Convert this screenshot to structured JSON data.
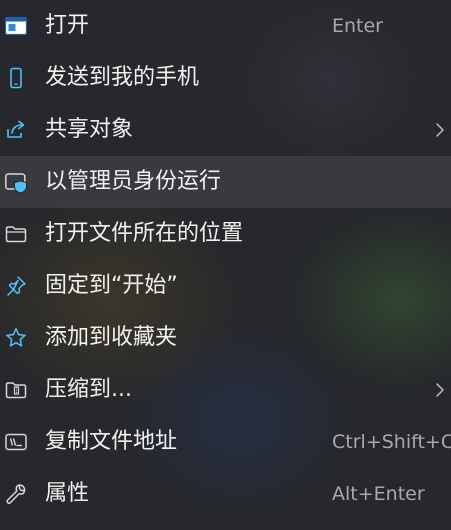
{
  "menu": {
    "items": [
      {
        "label": "打开",
        "shortcut": "Enter",
        "icon": "open-app-icon"
      },
      {
        "label": "发送到我的手机",
        "shortcut": "",
        "icon": "phone-icon"
      },
      {
        "label": "共享对象",
        "shortcut": "",
        "icon": "share-icon",
        "submenu": true
      },
      {
        "label": "以管理员身份运行",
        "shortcut": "",
        "icon": "admin-shield-icon",
        "hovered": true
      },
      {
        "label": "打开文件所在的位置",
        "shortcut": "",
        "icon": "folder-icon"
      },
      {
        "label": "固定到“开始”",
        "shortcut": "",
        "icon": "pin-icon"
      },
      {
        "label": "添加到收藏夹",
        "shortcut": "",
        "icon": "star-icon"
      },
      {
        "label": "压缩到...",
        "shortcut": "",
        "icon": "zip-folder-icon",
        "submenu": true
      },
      {
        "label": "复制文件地址",
        "shortcut": "Ctrl+Shift+C",
        "icon": "copy-path-icon"
      },
      {
        "label": "属性",
        "shortcut": "Alt+Enter",
        "icon": "wrench-icon"
      }
    ]
  },
  "colors": {
    "text": "#f2f2f2",
    "shortcut_text": "#a9a9a9",
    "accent": "#4cc2ff",
    "hover_bg": "rgba(255,255,255,0.085)"
  }
}
